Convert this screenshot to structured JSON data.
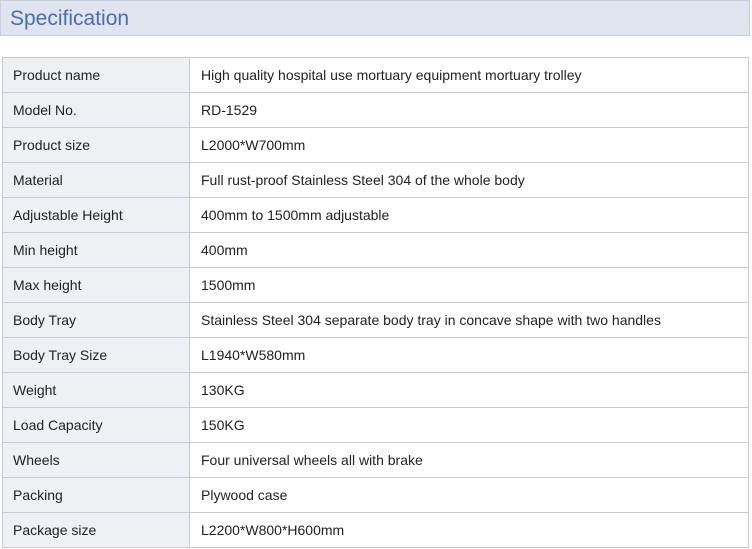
{
  "header": {
    "title": "Specification"
  },
  "colors": {
    "header_bg": "#dfe4ee",
    "title": "#4a6fa8",
    "label_bg": "#eef0f4",
    "border": "#c6ccd6"
  },
  "rows": [
    {
      "label": "Product name",
      "value": "High quality hospital use mortuary equipment mortuary trolley"
    },
    {
      "label": "Model No.",
      "value": "RD-1529"
    },
    {
      "label": "Product size",
      "value": "L2000*W700mm"
    },
    {
      "label": "Material",
      "value": "Full rust-proof Stainless Steel 304 of the whole body"
    },
    {
      "label": "Adjustable Height",
      "value": "400mm to 1500mm adjustable"
    },
    {
      "label": "Min height",
      "value": "400mm"
    },
    {
      "label": "Max height",
      "value": "1500mm"
    },
    {
      "label": "Body Tray",
      "value": "Stainless Steel 304 separate body tray in concave shape with two handles"
    },
    {
      "label": "Body Tray Size",
      "value": "L1940*W580mm"
    },
    {
      "label": "Weight",
      "value": "130KG"
    },
    {
      "label": "Load Capacity",
      "value": "150KG"
    },
    {
      "label": "Wheels",
      "value": "Four universal wheels all with brake"
    },
    {
      "label": "Packing",
      "value": "Plywood case"
    },
    {
      "label": "Package size",
      "value": "L2200*W800*H600mm"
    }
  ]
}
